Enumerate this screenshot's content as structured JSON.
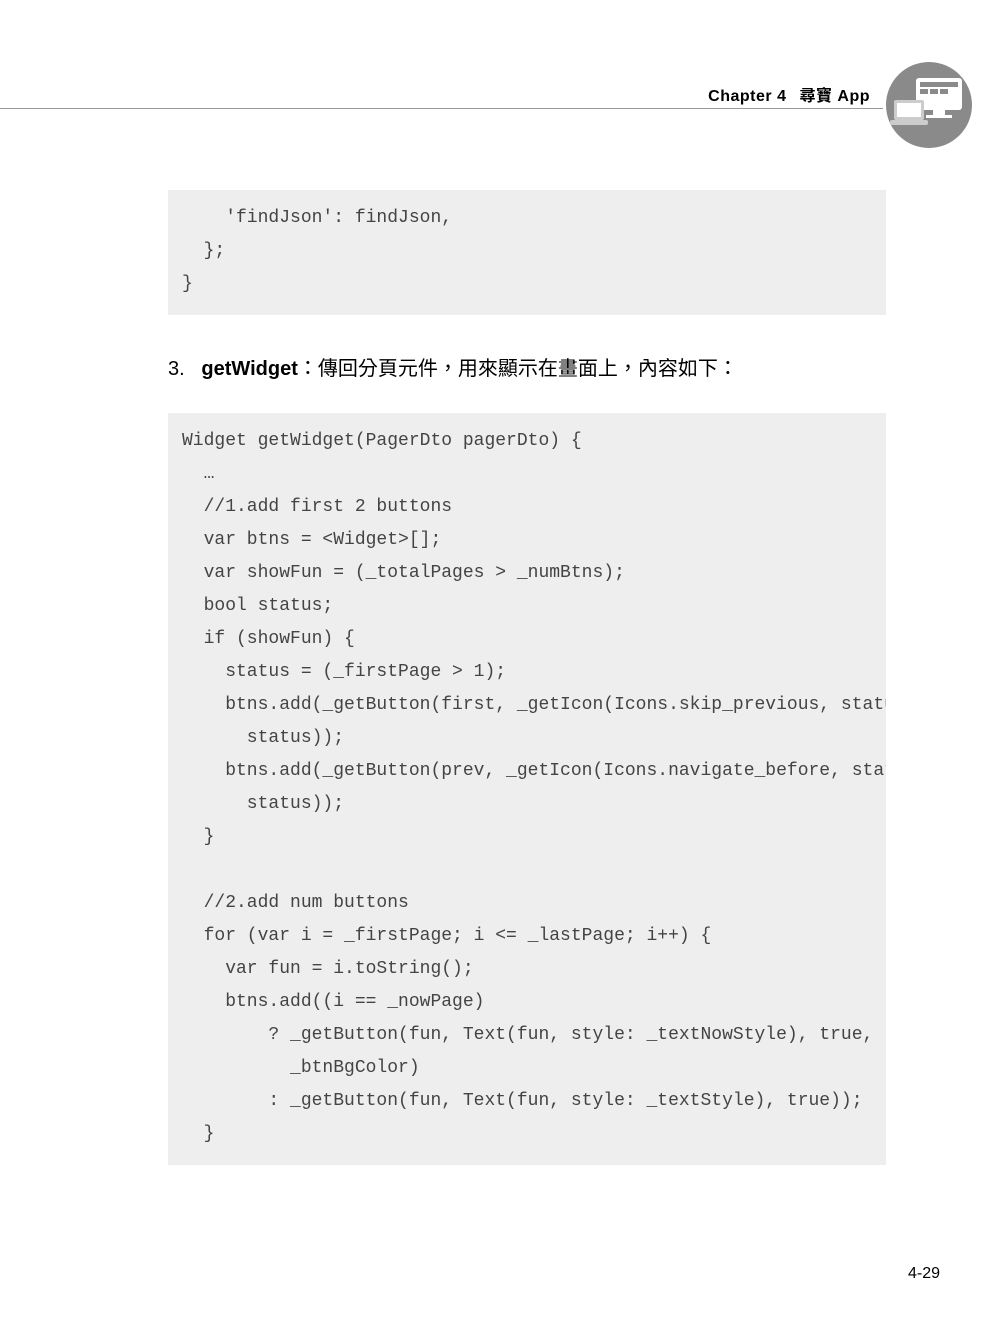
{
  "header": {
    "chapter_label": "Chapter",
    "chapter_number": "4",
    "chapter_title": "尋寶 App"
  },
  "code1": "    'findJson': findJson,\n  };\n}",
  "section": {
    "number": "3.",
    "name": "getWidget",
    "colon": "：",
    "desc": "傳回分頁元件，用來顯示在畫面上，內容如下："
  },
  "code2": "Widget getWidget(PagerDto pagerDto) {\n  …\n  //1.add first 2 buttons\n  var btns = <Widget>[];\n  var showFun = (_totalPages > _numBtns);\n  bool status;\n  if (showFun) {\n    status = (_firstPage > 1);\n    btns.add(_getButton(first, _getIcon(Icons.skip_previous, status),\n      status));\n    btns.add(_getButton(prev, _getIcon(Icons.navigate_before, status),\n      status));\n  }\n\n  //2.add num buttons\n  for (var i = _firstPage; i <= _lastPage; i++) {\n    var fun = i.toString();\n    btns.add((i == _nowPage)\n        ? _getButton(fun, Text(fun, style: _textNowStyle), true,\n          _btnBgColor)\n        : _getButton(fun, Text(fun, style: _textStyle), true));\n  }",
  "page_number": "4-29"
}
